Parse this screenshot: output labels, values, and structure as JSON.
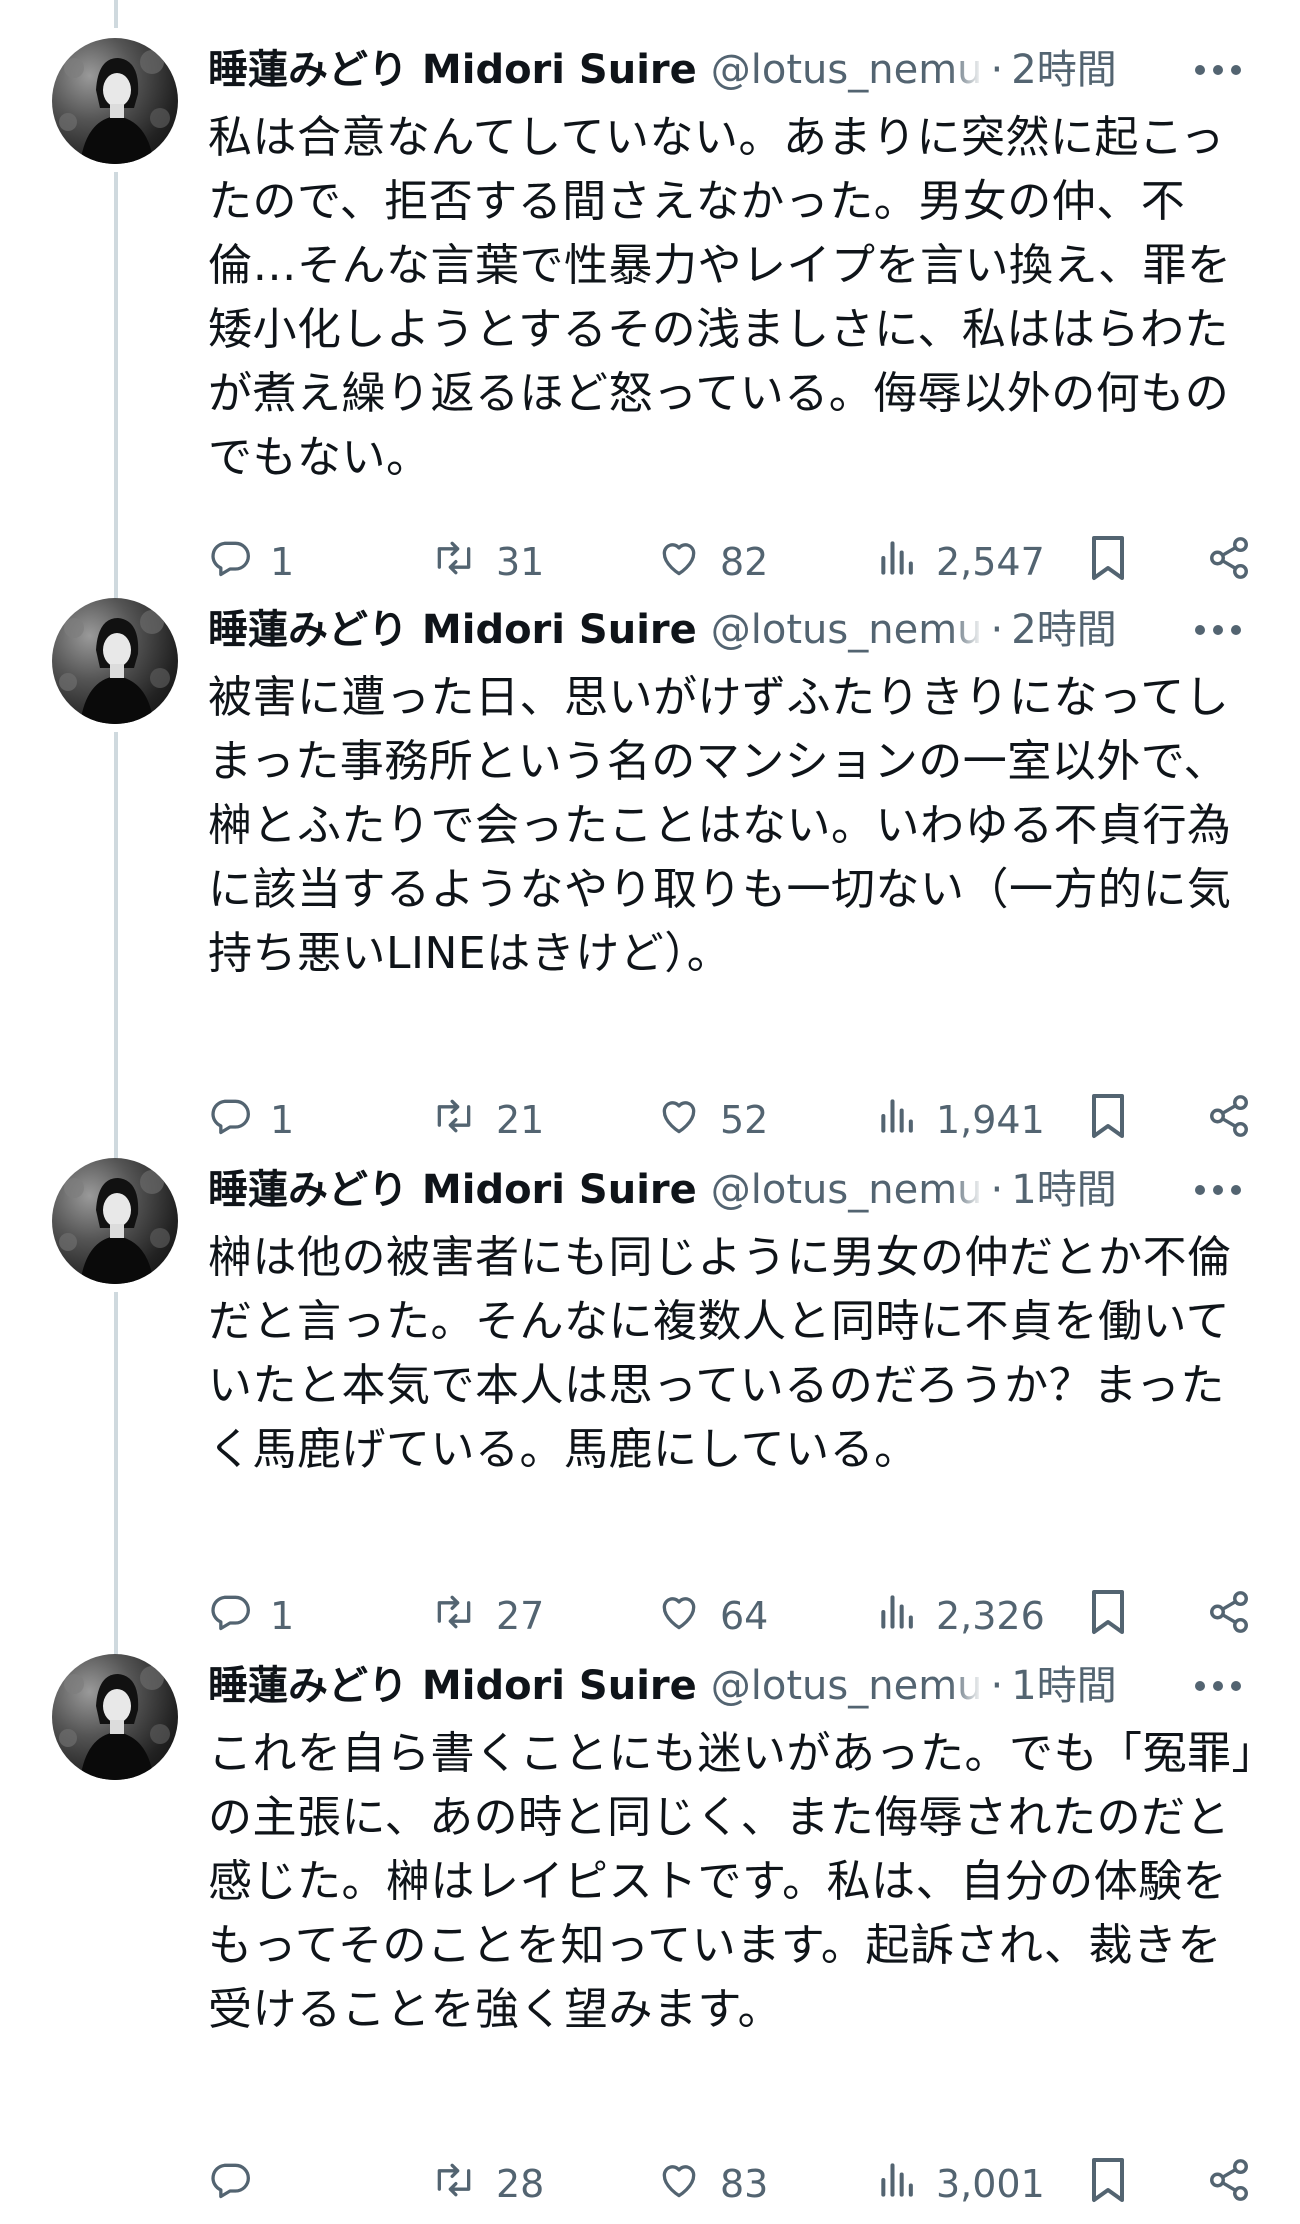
{
  "author": {
    "display_name": "睡蓮みどり Midori Suire",
    "handle": "@lotus_nemu"
  },
  "colors": {
    "text": "#0f1419",
    "muted": "#536471",
    "thread_line": "#cfd9de"
  },
  "icons": {
    "reply": "reply-icon",
    "retweet": "retweet-icon",
    "like": "like-icon",
    "views": "views-icon",
    "bookmark": "bookmark-icon",
    "share": "share-icon",
    "more": "more-icon"
  },
  "tweets": [
    {
      "time": "2時間",
      "text": "私は合意なんてしていない。あまりに突然に起こったので、拒否する間さえなかった。男女の仲、不倫…そんな言葉で性暴力やレイプを言い換え、罪を矮小化しようとするその浅ましさに、私ははらわたが煮え繰り返るほど怒っている。侮辱以外の何ものでもない。",
      "replies": "1",
      "retweets": "31",
      "likes": "82",
      "views": "2,547"
    },
    {
      "time": "2時間",
      "text": "被害に遭った日、思いがけずふたりきりになってしまった事務所という名のマンションの一室以外で、榊とふたりで会ったことはない。いわゆる不貞行為に該当するようなやり取りも一切ない（一方的に気持ち悪いLINEはきけど）。",
      "replies": "1",
      "retweets": "21",
      "likes": "52",
      "views": "1,941"
    },
    {
      "time": "1時間",
      "text": "榊は他の被害者にも同じように男女の仲だとか不倫だと言った。そんなに複数人と同時に不貞を働いていたと本気で本人は思っているのだろうか？まったく馬鹿げている。馬鹿にしている。",
      "replies": "1",
      "retweets": "27",
      "likes": "64",
      "views": "2,326"
    },
    {
      "time": "1時間",
      "text": "これを自ら書くことにも迷いがあった。でも「冤罪」の主張に、あの時と同じく、また侮辱されたのだと感じた。榊はレイピストです。私は、自分の体験をもってそのことを知っています。起訴され、裁きを受けることを強く望みます。",
      "replies": "",
      "retweets": "28",
      "likes": "83",
      "views": "3,001"
    }
  ]
}
